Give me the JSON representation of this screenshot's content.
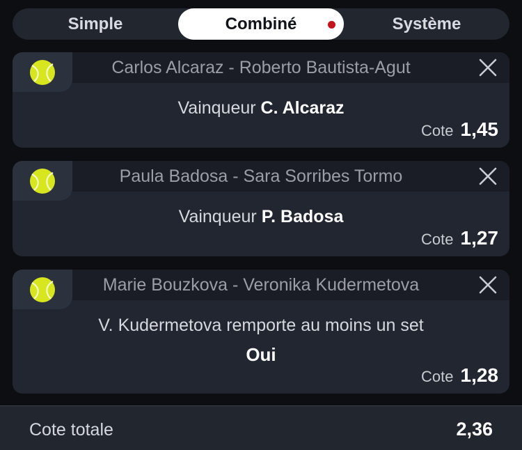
{
  "tabs": [
    {
      "label": "Simple"
    },
    {
      "label": "Combiné"
    },
    {
      "label": "Système"
    }
  ],
  "bets": [
    {
      "match": "Carlos Alcaraz - Roberto Bautista-Agut",
      "selection_prefix": "Vainqueur",
      "selection_value": "C. Alcaraz",
      "odds_label": "Cote",
      "odds": "1,45"
    },
    {
      "match": "Paula Badosa - Sara Sorribes Tormo",
      "selection_prefix": "Vainqueur",
      "selection_value": "P. Badosa",
      "odds_label": "Cote",
      "odds": "1,27"
    },
    {
      "match": "Marie Bouzkova - Veronika Kudermetova",
      "selection_text": "V. Kudermetova remporte au moins un set",
      "selection_answer": "Oui",
      "odds_label": "Cote",
      "odds": "1,28"
    }
  ],
  "footer": {
    "label": "Cote totale",
    "value": "2,36"
  },
  "icons": {
    "sport": "tennis-ball-icon",
    "remove": "close-icon",
    "unsaved": "red-dot-indicator"
  },
  "colors": {
    "background": "#0d0e12",
    "card": "#212631",
    "ball": "#d8e620",
    "indicator": "#c3131b"
  }
}
